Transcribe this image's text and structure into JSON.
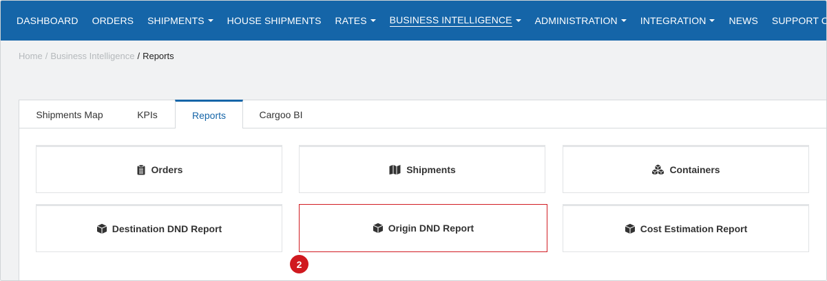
{
  "nav": {
    "items": [
      {
        "label": "DASHBOARD",
        "caret": false,
        "active": false
      },
      {
        "label": "ORDERS",
        "caret": false,
        "active": false
      },
      {
        "label": "SHIPMENTS",
        "caret": true,
        "active": false
      },
      {
        "label": "HOUSE SHIPMENTS",
        "caret": false,
        "active": false
      },
      {
        "label": "RATES",
        "caret": true,
        "active": false
      },
      {
        "label": "BUSINESS INTELLIGENCE",
        "caret": true,
        "active": true
      },
      {
        "label": "ADMINISTRATION",
        "caret": true,
        "active": false
      },
      {
        "label": "INTEGRATION",
        "caret": true,
        "active": false
      },
      {
        "label": "NEWS",
        "caret": false,
        "active": false
      },
      {
        "label": "SUPPORT CENTER",
        "caret": false,
        "active": false
      }
    ]
  },
  "breadcrumb": {
    "home": "Home",
    "sep1": "/",
    "section": "Business Intelligence",
    "sep2": "/",
    "current": "Reports"
  },
  "tabs": [
    {
      "label": "Shipments Map",
      "active": false
    },
    {
      "label": "KPIs",
      "active": false
    },
    {
      "label": "Reports",
      "active": true
    },
    {
      "label": "Cargoo BI",
      "active": false
    }
  ],
  "reports": {
    "orders": {
      "label": "Orders",
      "icon": "clipboard-icon"
    },
    "shipments": {
      "label": "Shipments",
      "icon": "map-icon"
    },
    "containers": {
      "label": "Containers",
      "icon": "cubes-icon"
    },
    "destination_dnd": {
      "label": "Destination DND Report",
      "icon": "cube-icon"
    },
    "origin_dnd": {
      "label": "Origin DND Report",
      "icon": "cube-icon"
    },
    "cost_estimation": {
      "label": "Cost Estimation Report",
      "icon": "cube-icon"
    }
  },
  "step_badge": "2",
  "colors": {
    "nav_bg": "#1565a8",
    "accent": "#1565a8",
    "highlight": "#d0191f"
  }
}
